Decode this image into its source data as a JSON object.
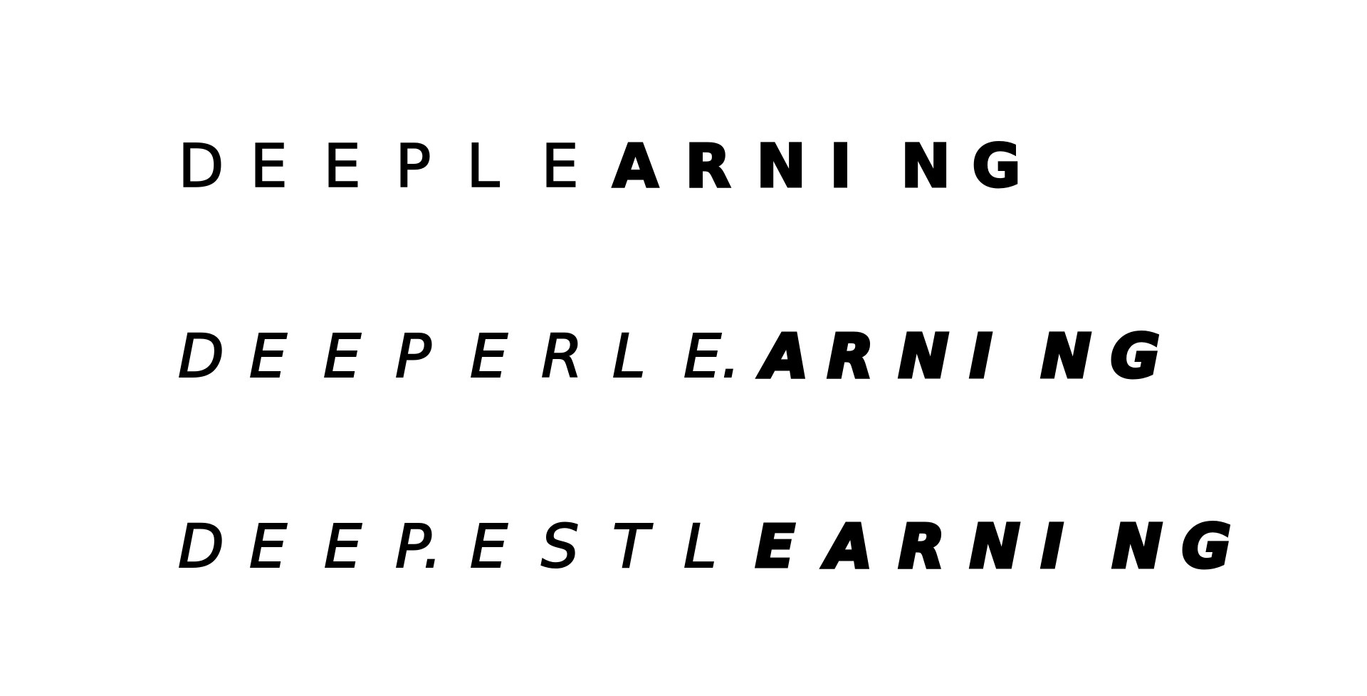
{
  "lines": [
    {
      "name": "line-1",
      "letters": [
        "D",
        "E",
        "E",
        "P",
        "L",
        "E",
        "A",
        "R",
        "N",
        "I",
        "N",
        "G"
      ]
    },
    {
      "name": "line-2",
      "letters": [
        "D",
        "E",
        "E",
        "P",
        "E",
        "R",
        "L",
        "E.",
        "A",
        "R",
        "N",
        "I",
        "N",
        "G"
      ]
    },
    {
      "name": "line-3",
      "letters": [
        "D",
        "E",
        "E",
        "P.",
        "E",
        "S",
        "T",
        "L",
        "E",
        "A",
        "R",
        "N",
        "I",
        "N",
        "G"
      ]
    }
  ],
  "colors": {
    "background": "#ffffff",
    "ink": "#000000"
  }
}
